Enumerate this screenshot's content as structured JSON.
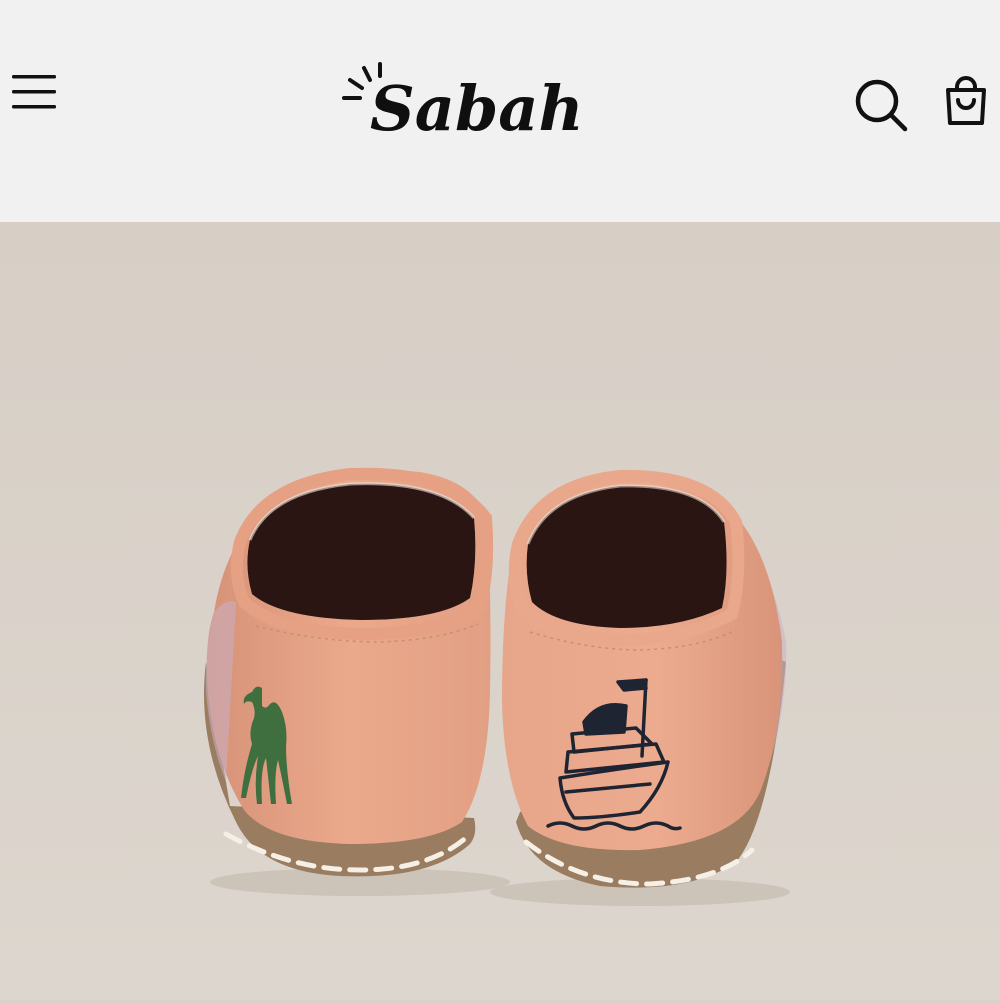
{
  "header": {
    "brand": "Sabah",
    "menu_icon": "hamburger-menu-icon",
    "search_icon": "search-icon",
    "cart_icon": "shopping-bag-icon",
    "logo_sun_icon": "sun-rays-icon"
  },
  "product_image": {
    "left_shoe_motif": "camel-icon",
    "right_shoe_motif": "ship-icon"
  },
  "colors": {
    "header_bg": "#f1f1f1",
    "page_bg": "#d9d2ca",
    "shoe_leather": "#e9a68a",
    "sole": "#9c7e62",
    "camel_green": "#3f6f3f",
    "ship_navy": "#1e2432"
  }
}
